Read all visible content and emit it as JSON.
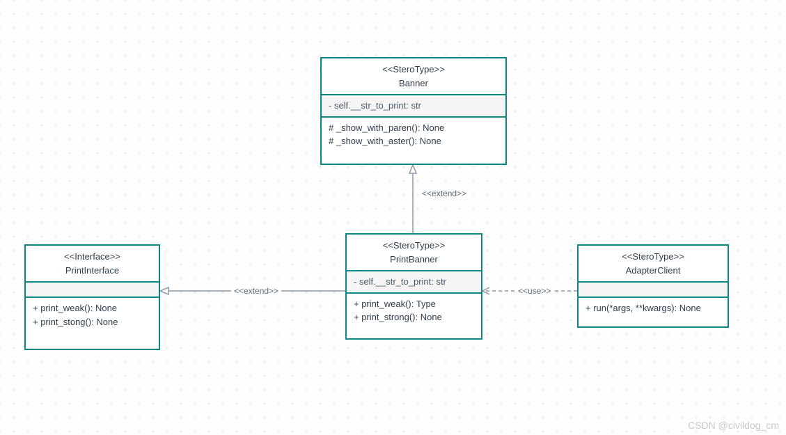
{
  "watermark": "CSDN @civildog_cm",
  "edges": {
    "extend1": "<<extend>>",
    "extend2": "<<extend>>",
    "use": "<<use>>"
  },
  "banner": {
    "stereotype": "<<SteroType>>",
    "name": "Banner",
    "attr1": "- self.__str_to_print: str",
    "op1": "#  _show_with_paren(): None",
    "op2": "# _show_with_aster(): None"
  },
  "printInterface": {
    "stereotype": "<<Interface>>",
    "name": "PrintInterface",
    "op1": "+ print_weak(): None",
    "op2": "+ print_stong(): None"
  },
  "printBanner": {
    "stereotype": "<<SteroType>>",
    "name": "PrintBanner",
    "attr1": "-  self.__str_to_print: str",
    "op1": "+  print_weak(): Type",
    "op2": "+ print_strong(): None"
  },
  "adapterClient": {
    "stereotype": "<<SteroType>>",
    "name": "AdapterClient",
    "op1": "+ run(*args, **kwargs): None"
  }
}
